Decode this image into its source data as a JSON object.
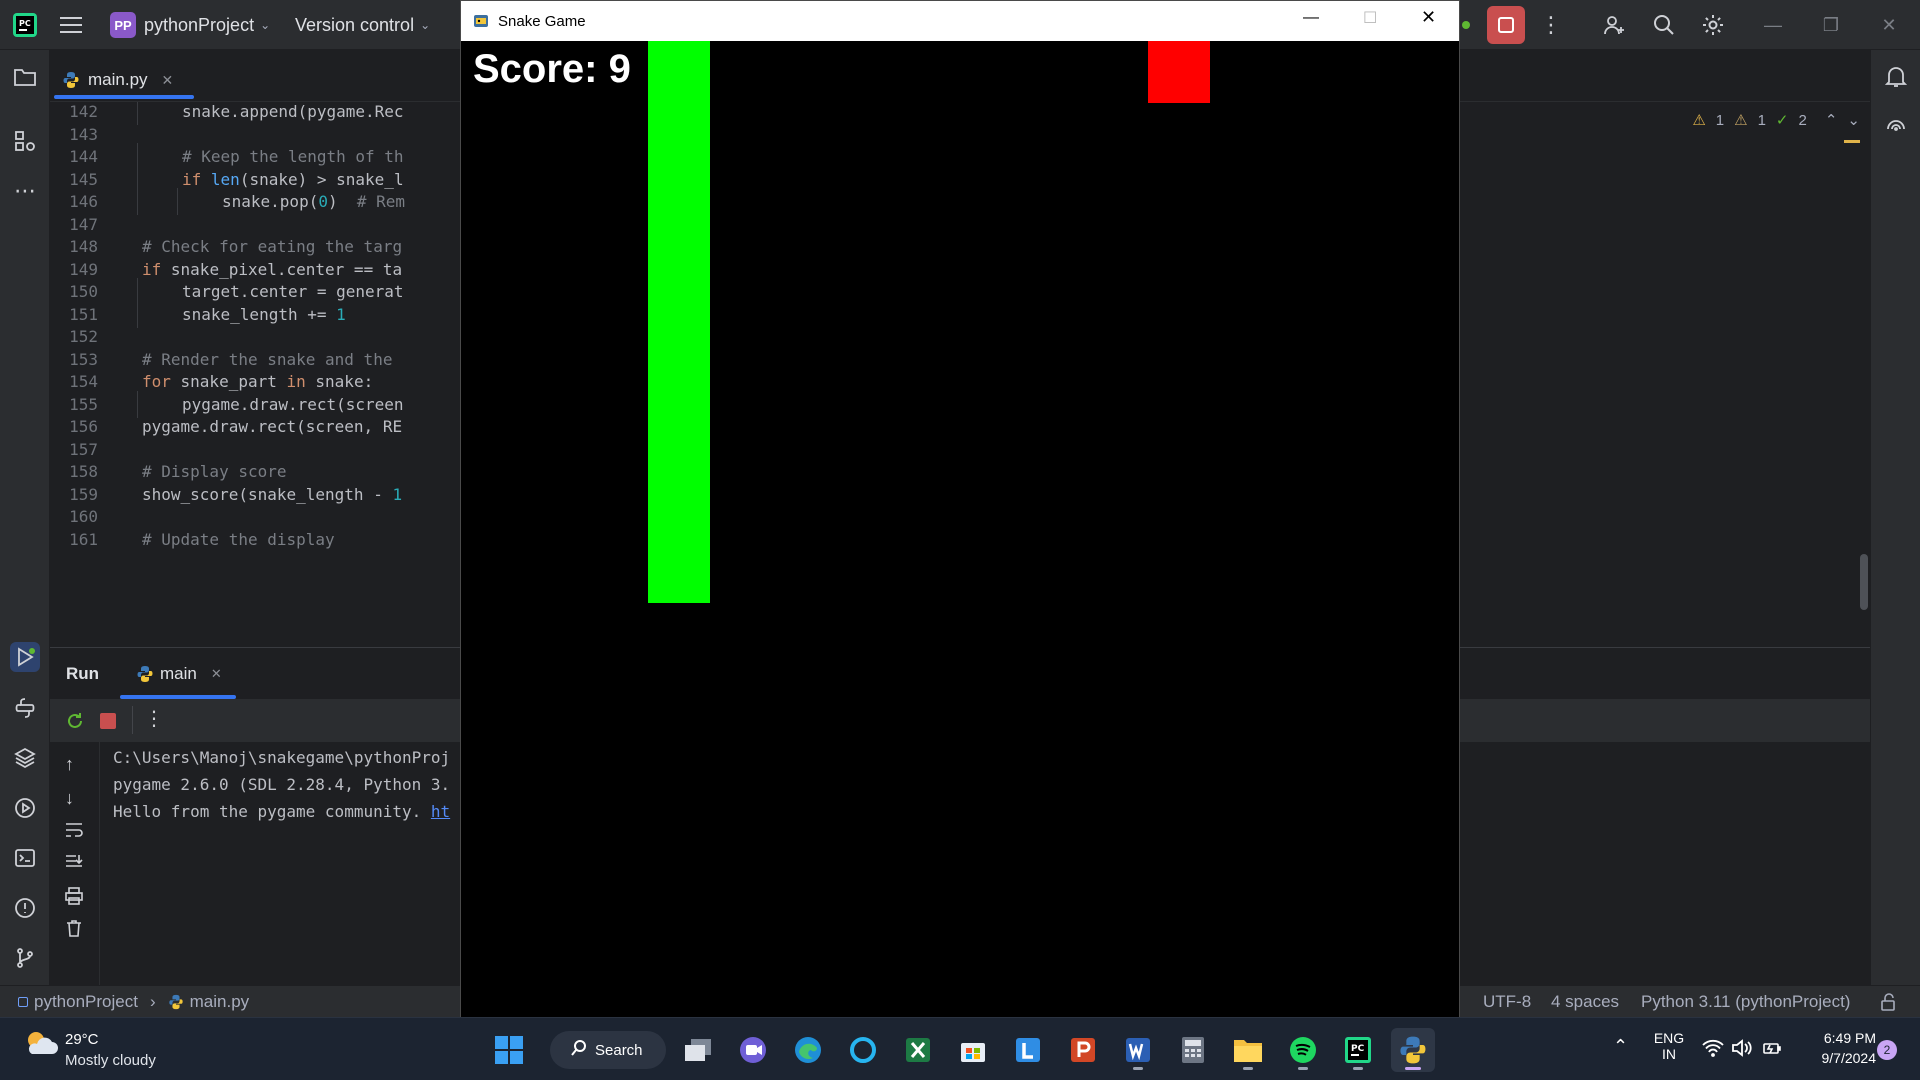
{
  "ide": {
    "project_badge": "PP",
    "project_name": "pythonProject",
    "vcs": "Version control",
    "tab_file": "main.py",
    "inspections": {
      "warn1": "1",
      "warn2": "1",
      "ok": "2"
    },
    "code_lines": [
      {
        "n": "142",
        "indent": 2,
        "parts": [
          [
            "snake.append(pygame.Rec",
            ""
          ]
        ]
      },
      {
        "n": "143",
        "indent": 0,
        "parts": []
      },
      {
        "n": "144",
        "indent": 2,
        "parts": [
          [
            "# Keep the length of th",
            "cm"
          ]
        ]
      },
      {
        "n": "145",
        "indent": 2,
        "parts": [
          [
            "if ",
            "kw"
          ],
          [
            "len",
            "bi"
          ],
          [
            "(snake) > snake_l",
            ""
          ]
        ]
      },
      {
        "n": "146",
        "indent": 3,
        "parts": [
          [
            "snake.pop(",
            ""
          ],
          [
            "0",
            "num"
          ],
          [
            ")  ",
            ""
          ],
          [
            "# Rem",
            "cm"
          ]
        ]
      },
      {
        "n": "147",
        "indent": 0,
        "parts": []
      },
      {
        "n": "148",
        "indent": 1,
        "parts": [
          [
            "# Check for eating the targ",
            "cm"
          ]
        ]
      },
      {
        "n": "149",
        "indent": 1,
        "parts": [
          [
            "if ",
            "kw"
          ],
          [
            "snake_pixel.center == ta",
            ""
          ]
        ]
      },
      {
        "n": "150",
        "indent": 2,
        "parts": [
          [
            "target.center = generat",
            ""
          ]
        ]
      },
      {
        "n": "151",
        "indent": 2,
        "parts": [
          [
            "snake_length += ",
            ""
          ],
          [
            "1",
            "num"
          ]
        ]
      },
      {
        "n": "152",
        "indent": 0,
        "parts": []
      },
      {
        "n": "153",
        "indent": 1,
        "parts": [
          [
            "# Render the snake and the ",
            "cm"
          ]
        ]
      },
      {
        "n": "154",
        "indent": 1,
        "parts": [
          [
            "for ",
            "kw"
          ],
          [
            "snake_part ",
            ""
          ],
          [
            "in ",
            "kw"
          ],
          [
            "snake:",
            ""
          ]
        ]
      },
      {
        "n": "155",
        "indent": 2,
        "parts": [
          [
            "pygame.draw.rect(screen",
            ""
          ]
        ]
      },
      {
        "n": "156",
        "indent": 1,
        "parts": [
          [
            "pygame.draw.rect(screen, RE",
            ""
          ]
        ]
      },
      {
        "n": "157",
        "indent": 0,
        "parts": []
      },
      {
        "n": "158",
        "indent": 1,
        "parts": [
          [
            "# Display score",
            "cm"
          ]
        ]
      },
      {
        "n": "159",
        "indent": 1,
        "parts": [
          [
            "show_score(snake_length - ",
            ""
          ],
          [
            "1",
            "num"
          ]
        ]
      },
      {
        "n": "160",
        "indent": 0,
        "parts": []
      },
      {
        "n": "161",
        "indent": 1,
        "parts": [
          [
            "# Update the display",
            "cm"
          ]
        ]
      }
    ],
    "run": {
      "title": "Run",
      "tab": "main",
      "console": [
        "C:\\Users\\Manoj\\snakegame\\pythonProj",
        "pygame 2.6.0 (SDL 2.28.4, Python 3.",
        "Hello from the pygame community. "
      ],
      "console_link": "ht"
    },
    "status": {
      "breadcrumb_project": "pythonProject",
      "breadcrumb_file": "main.py",
      "encoding": "UTF-8",
      "indent": "4 spaces",
      "interpreter": "Python 3.11 (pythonProject)"
    }
  },
  "game": {
    "window_title": "Snake Game",
    "score_text": "Score: 9",
    "snake_color": "#00ff00",
    "target_color": "#ff0000"
  },
  "taskbar": {
    "temperature": "29°C",
    "weather": "Mostly cloudy",
    "search": "Search",
    "lang_top": "ENG",
    "lang_bottom": "IN",
    "time": "6:49 PM",
    "date": "9/7/2024",
    "notif_count": "2"
  }
}
